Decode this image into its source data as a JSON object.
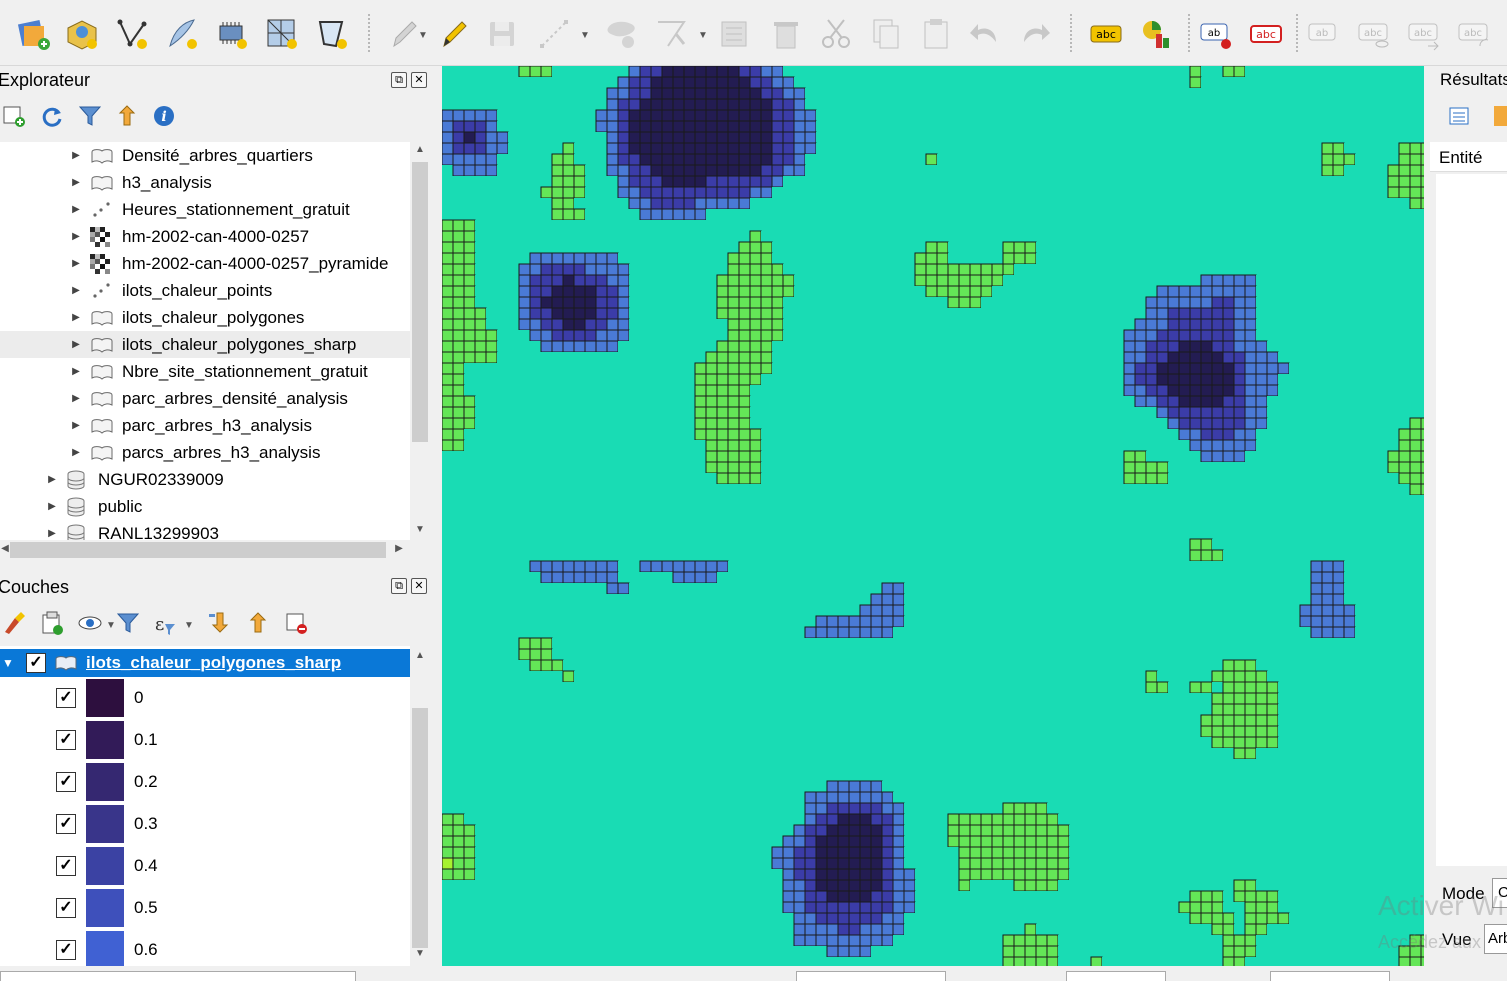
{
  "browser_panel": {
    "title": "Explorateur",
    "items": [
      {
        "label": "Densité_arbres_quartiers",
        "icon": "polygon-layer-icon",
        "level": 2
      },
      {
        "label": "h3_analysis",
        "icon": "polygon-layer-icon",
        "level": 2
      },
      {
        "label": "Heures_stationnement_gratuit",
        "icon": "point-layer-icon",
        "level": 2
      },
      {
        "label": "hm-2002-can-4000-0257",
        "icon": "raster-layer-icon",
        "level": 2
      },
      {
        "label": "hm-2002-can-4000-0257_pyramide",
        "icon": "raster-layer-icon",
        "level": 2
      },
      {
        "label": "ilots_chaleur_points",
        "icon": "point-layer-icon",
        "level": 2
      },
      {
        "label": "ilots_chaleur_polygones",
        "icon": "polygon-layer-icon",
        "level": 2
      },
      {
        "label": "ilots_chaleur_polygones_sharp",
        "icon": "polygon-layer-icon",
        "level": 2,
        "selected": true
      },
      {
        "label": "Nbre_site_stationnement_gratuit",
        "icon": "polygon-layer-icon",
        "level": 2
      },
      {
        "label": "parc_arbres_densité_analysis",
        "icon": "polygon-layer-icon",
        "level": 2
      },
      {
        "label": "parc_arbres_h3_analysis",
        "icon": "polygon-layer-icon",
        "level": 2
      },
      {
        "label": "parcs_arbres_h3_analysis",
        "icon": "polygon-layer-icon",
        "level": 2
      },
      {
        "label": "NGUR02339009",
        "icon": "database-icon",
        "level": 1
      },
      {
        "label": "public",
        "icon": "database-icon",
        "level": 1
      },
      {
        "label": "RANL13299903",
        "icon": "database-icon",
        "level": 1
      }
    ]
  },
  "layers_panel": {
    "title": "Couches",
    "layer": {
      "name": "ilots_chaleur_polygones_sharp",
      "checked": true
    },
    "legend": [
      {
        "label": "0",
        "color": "#2d0f3e"
      },
      {
        "label": "0.1",
        "color": "#321b58"
      },
      {
        "label": "0.2",
        "color": "#352871"
      },
      {
        "label": "0.3",
        "color": "#39358a"
      },
      {
        "label": "0.4",
        "color": "#3b42a3"
      },
      {
        "label": "0.5",
        "color": "#3e50bb"
      },
      {
        "label": "0.6",
        "color": "#4061d3"
      }
    ]
  },
  "right_panel": {
    "title": "Résultats",
    "entity_label": "Entité",
    "mode_label": "Mode",
    "view_label": "Vue",
    "view_value": "Arb"
  },
  "watermark": {
    "line1": "Activer Wi",
    "line2": "Accédez aux"
  },
  "map_colors": {
    "base": "#19dcb4",
    "lime": "#a6f22e",
    "green": "#64e657",
    "orange": "#f5b73a",
    "blue": "#4a7ad6",
    "darkblue": "#3b3ca8",
    "navy": "#231c52",
    "cyan": "#27c5d8"
  }
}
